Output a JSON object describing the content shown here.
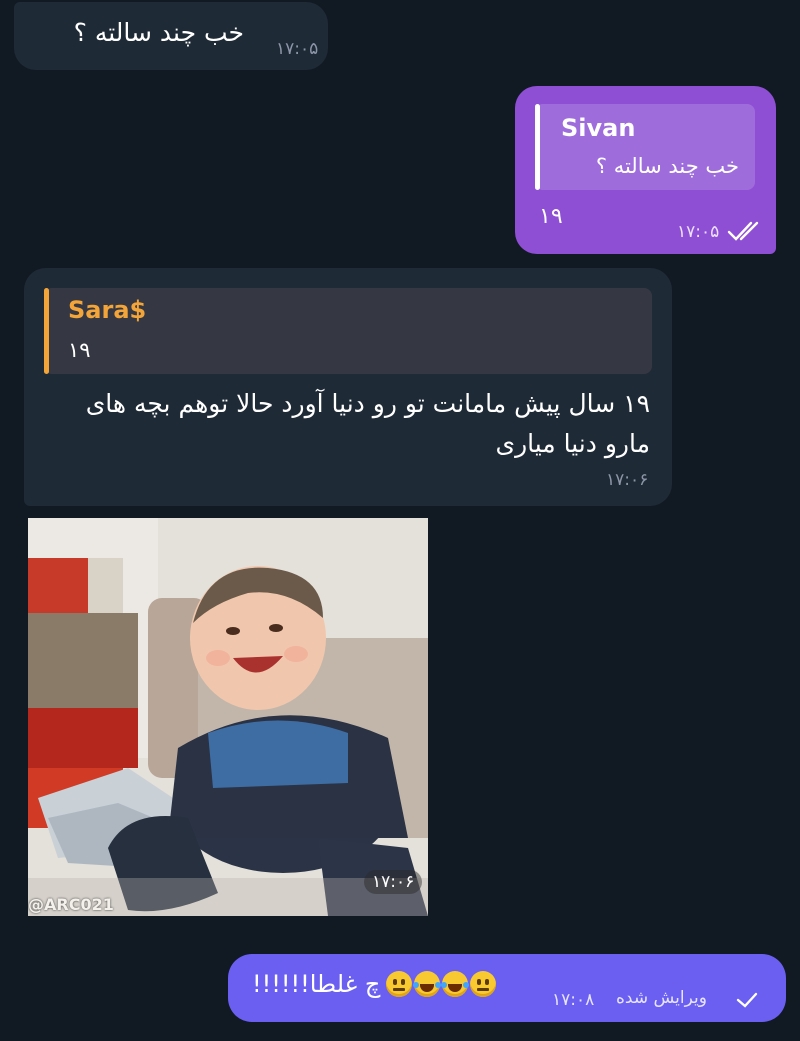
{
  "messages": {
    "m1": {
      "text": "خب چند سالته ؟",
      "time": "۱۷:۰۵"
    },
    "m2": {
      "reply_name": "Sivan",
      "reply_text": "خب چند سالته ؟",
      "text": "۱۹",
      "time": "۱۷:۰۵",
      "status": "read"
    },
    "m3": {
      "reply_name": "Sara$",
      "reply_text": "۱۹",
      "text": "۱۹ سال پیش مامانت تو رو دنیا آورد حالا توهم بچه های مارو دنیا میاری",
      "time": "۱۷:۰۶"
    },
    "m4": {
      "watermark": "@ARC021",
      "time": "۱۷:۰۶"
    },
    "m5": {
      "text": "چ غلطا!!!!!!",
      "edited_label": "ویرایش شده",
      "time": "۱۷:۰۸",
      "status": "sent"
    }
  },
  "colors": {
    "background": "#111923",
    "incoming_bubble": "#1f2a37",
    "outgoing_bubble": "#8e4fd4",
    "outgoing_bubble_2": "#6a5ff0",
    "reply_name_incoming": "#f3a53a"
  },
  "icons": {
    "read_status": "double-check-icon",
    "sent_status": "check-icon"
  }
}
